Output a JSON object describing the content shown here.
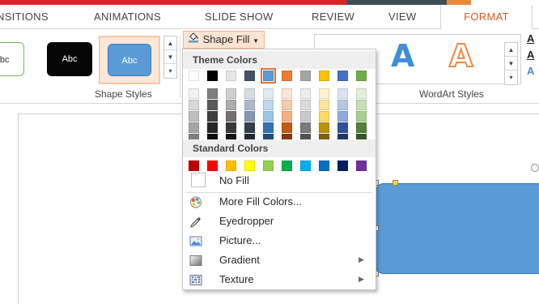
{
  "tabs": [
    {
      "label": "NSITIONS"
    },
    {
      "label": "ANIMATIONS"
    },
    {
      "label": "SLIDE SHOW"
    },
    {
      "label": "REVIEW"
    },
    {
      "label": "VIEW"
    },
    {
      "label": "FORMAT",
      "active": true
    }
  ],
  "ribbon": {
    "shape_styles": {
      "tile_labels": [
        "Abc",
        "Abc",
        "Abc"
      ],
      "group_label": "Shape Styles"
    },
    "shape_fill_button": "Shape Fill",
    "wordart": {
      "letters": [
        "A",
        "A"
      ],
      "group_label": "WordArt Styles",
      "side_letters": [
        "A",
        "A",
        "A"
      ]
    }
  },
  "dropdown": {
    "theme_colors_heading": "Theme Colors",
    "theme_colors": [
      [
        "#ffffff",
        "#000000",
        "#e7e6e6",
        "#44546a",
        "#5b9bd5",
        "#ed7d31",
        "#a5a5a5",
        "#ffc000",
        "#4472c4",
        "#70ad47"
      ],
      [
        "#f2f2f2",
        "#7f7f7f",
        "#d0cece",
        "#d6dce4",
        "#deebf6",
        "#fbe5d5",
        "#ededed",
        "#fff2cc",
        "#dae3f3",
        "#e2efd9"
      ],
      [
        "#d8d8d8",
        "#595959",
        "#aeabab",
        "#adb9ca",
        "#bdd7ee",
        "#f7cbac",
        "#dbdbdb",
        "#fee599",
        "#b4c7e7",
        "#c5e0b3"
      ],
      [
        "#bfbfbf",
        "#3f3f3f",
        "#757070",
        "#8496b0",
        "#9dc3e6",
        "#f4b183",
        "#c9c9c9",
        "#ffd965",
        "#8eaadb",
        "#a8d08d"
      ],
      [
        "#a5a5a5",
        "#262626",
        "#3a3838",
        "#323f4f",
        "#2e75b5",
        "#c55a11",
        "#7b7b7b",
        "#bf9000",
        "#2f5496",
        "#538135"
      ],
      [
        "#7f7f7f",
        "#0c0c0c",
        "#171616",
        "#222a35",
        "#1e4e79",
        "#833c0b",
        "#525252",
        "#7f6000",
        "#1f3864",
        "#375623"
      ]
    ],
    "selected_theme_color": [
      0,
      4
    ],
    "standard_colors_heading": "Standard Colors",
    "standard_colors": [
      "#c00000",
      "#ff0000",
      "#ffc000",
      "#ffff00",
      "#92d050",
      "#00b050",
      "#00b0f0",
      "#0070c0",
      "#002060",
      "#7030a0"
    ],
    "no_fill": "No Fill",
    "items": [
      {
        "label": "More Fill Colors...",
        "icon": "palette-icon",
        "submenu": false
      },
      {
        "label": "Eyedropper",
        "icon": "eyedropper-icon",
        "submenu": false
      },
      {
        "label": "Picture...",
        "icon": "picture-icon",
        "submenu": false
      },
      {
        "label": "Gradient",
        "icon": "gradient-icon",
        "submenu": true
      },
      {
        "label": "Texture",
        "icon": "texture-icon",
        "submenu": true
      }
    ]
  },
  "colors": {
    "accent": "#d35a1f",
    "selected_shape_fill": "#5b9bd5"
  }
}
